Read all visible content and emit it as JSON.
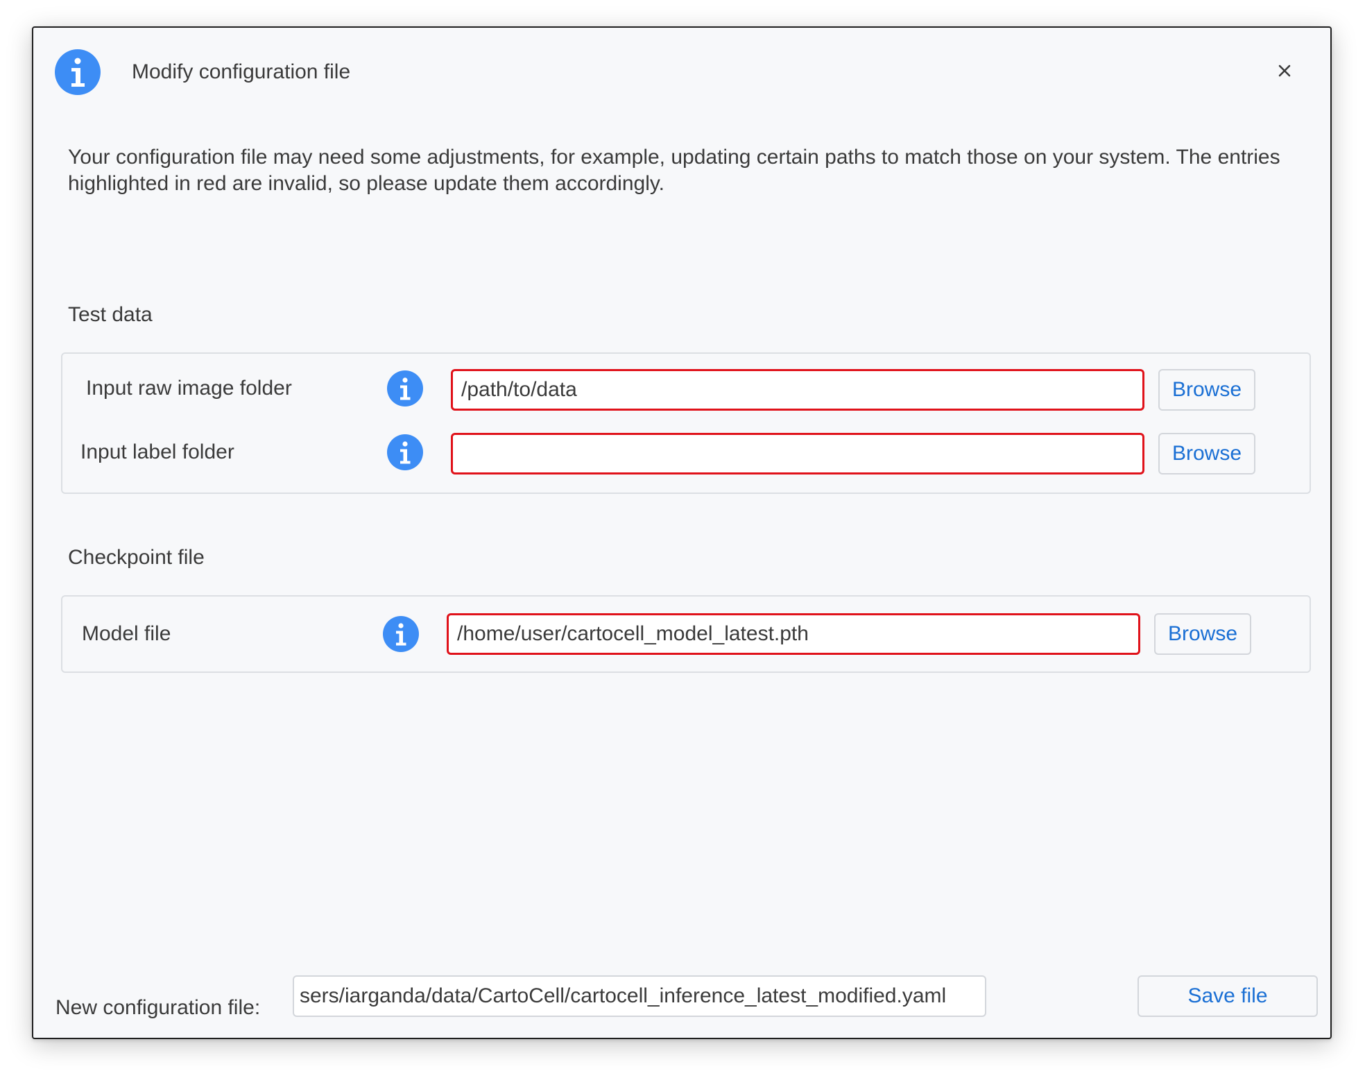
{
  "dialog": {
    "title": "Modify configuration file",
    "title_icon": "info-icon",
    "close_icon": "close-icon"
  },
  "description": "Your configuration file may need some adjustments, for example, updating certain paths to match those on your system. The entries highlighted in red are invalid, so please update them accordingly.",
  "sections": [
    {
      "title": "Test data",
      "rows": [
        {
          "label": "Input raw image folder",
          "value": "/path/to/data",
          "browse_label": "Browse",
          "invalid": true,
          "info_icon": "info-icon"
        },
        {
          "label": "Input label folder",
          "value": "",
          "browse_label": "Browse",
          "invalid": true,
          "info_icon": "info-icon"
        }
      ]
    },
    {
      "title": "Checkpoint file",
      "rows": [
        {
          "label": "Model file",
          "value": "/home/user/cartocell_model_latest.pth",
          "browse_label": "Browse",
          "invalid": true,
          "info_icon": "info-icon"
        }
      ]
    }
  ],
  "footer": {
    "label": "New configuration file:",
    "value": "sers/iarganda/data/CartoCell/cartocell_inference_latest_modified.yaml",
    "save_label": "Save file"
  },
  "colors": {
    "accent": "#1a6fd4",
    "info_icon": "#3d8df5",
    "invalid_border": "#e0121a",
    "background": "#f7f8fa"
  }
}
